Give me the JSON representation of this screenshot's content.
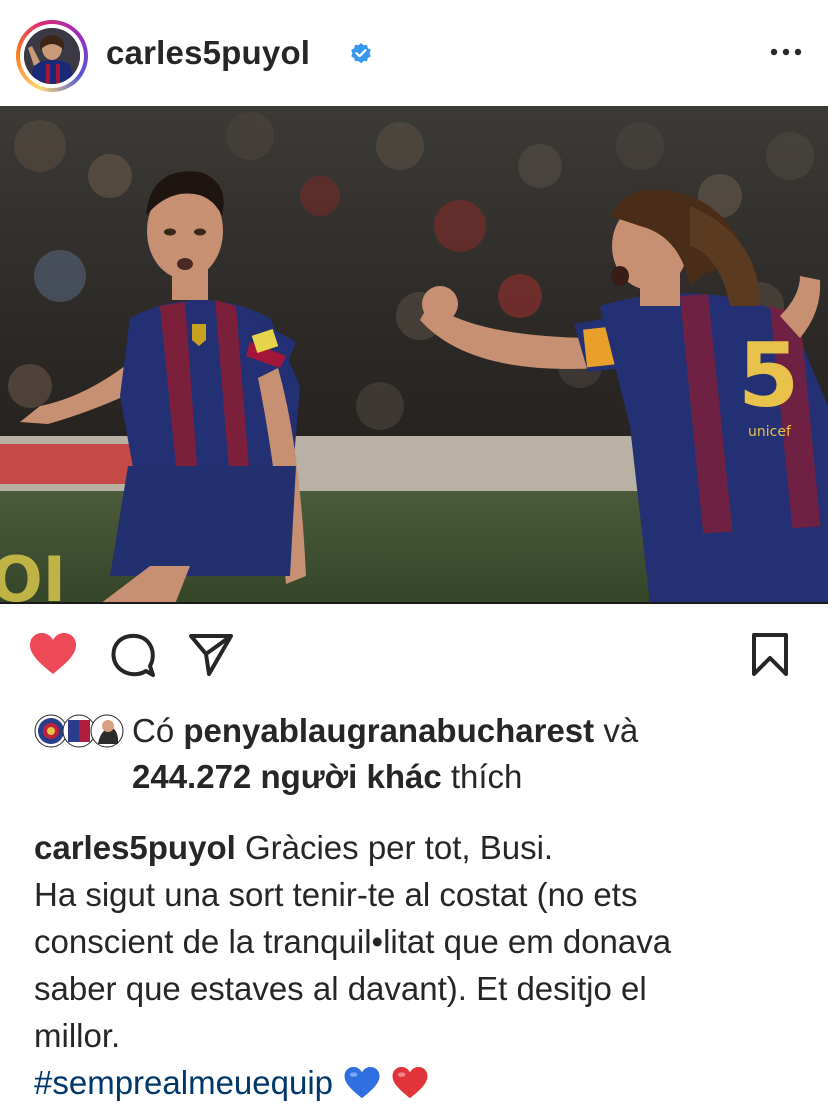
{
  "post": {
    "username": "carles5puyol",
    "verified": true,
    "more_icon": "more-horizontal-icon"
  },
  "actions": {
    "like_icon": "heart-filled-icon",
    "liked": true,
    "like_color": "#ed4956",
    "comment_icon": "comment-icon",
    "share_icon": "send-icon",
    "save_icon": "bookmark-icon"
  },
  "likes": {
    "prefix": "Có",
    "first_liker": "penyablaugranabucharest",
    "conjunction": "và",
    "others_count": "244.272 người khác",
    "suffix": "thích"
  },
  "caption": {
    "username": "carles5puyol",
    "first_line": "Gràcies per tot, Busi.",
    "lines": [
      "Ha sigut una sort tenir-te al costat (no ets",
      "conscient de la tranquil•litat que em donava",
      "saber que estaves al davant). Et desitjo el",
      "millor."
    ],
    "hashtag": "#semprealmeuequip",
    "emojis": [
      "💙",
      "❤️"
    ]
  },
  "colors": {
    "text": "#262626",
    "hashtag": "#00376b",
    "verified": "#3897f0",
    "heart": "#ed4956"
  }
}
